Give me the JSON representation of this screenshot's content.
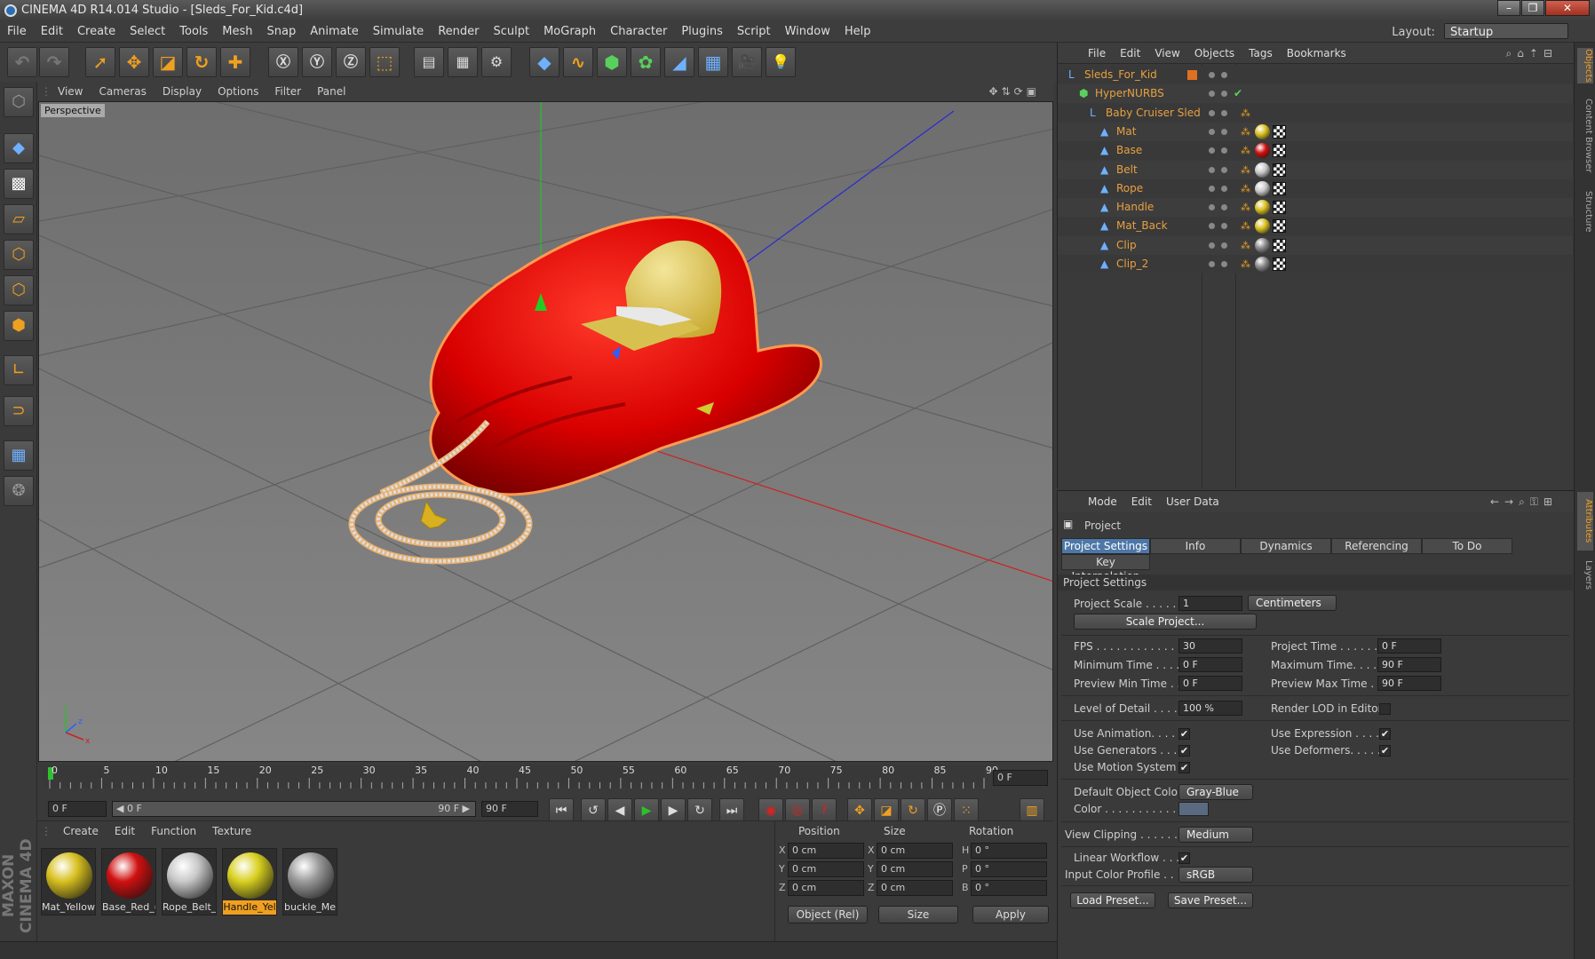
{
  "app": {
    "title": "CINEMA 4D R14.014 Studio - [Sleds_For_Kid.c4d]",
    "layout_label": "Layout:",
    "layout_value": "Startup"
  },
  "menu": [
    "File",
    "Edit",
    "Create",
    "Select",
    "Tools",
    "Mesh",
    "Snap",
    "Animate",
    "Simulate",
    "Render",
    "Sculpt",
    "MoGraph",
    "Character",
    "Plugins",
    "Script",
    "Window",
    "Help"
  ],
  "viewport": {
    "menu": [
      "View",
      "Cameras",
      "Display",
      "Options",
      "Filter",
      "Panel"
    ],
    "label": "Perspective"
  },
  "timeline": {
    "ticks": [
      "0",
      "5",
      "10",
      "15",
      "20",
      "25",
      "30",
      "35",
      "40",
      "45",
      "50",
      "55",
      "60",
      "65",
      "70",
      "75",
      "80",
      "85",
      "90"
    ],
    "frame_end_field": "0 F",
    "current_frame": "0 F",
    "range_start": "◀ 0 F",
    "range_end": "90 F ▶",
    "max_frame": "90 F"
  },
  "materials": {
    "menu": [
      "Create",
      "Edit",
      "Function",
      "Texture"
    ],
    "items": [
      {
        "name": "Mat_Yellow",
        "color": "#d8c020"
      },
      {
        "name": "Base_Red_(",
        "color": "#d01010"
      },
      {
        "name": "Rope_Belt_",
        "color": "#c8c8c8"
      },
      {
        "name": "Handle_Yel",
        "color": "#d8d020",
        "selected": true
      },
      {
        "name": "buckle_Me",
        "color": "#9a9a9a"
      }
    ],
    "brand": "MAXON CINEMA 4D"
  },
  "coords": {
    "headers": [
      "Position",
      "Size",
      "Rotation"
    ],
    "rows": [
      {
        "axis": "X",
        "pos": "0 cm",
        "size_axis": "X",
        "size": "0 cm",
        "rot_axis": "H",
        "rot": "0 °"
      },
      {
        "axis": "Y",
        "pos": "0 cm",
        "size_axis": "Y",
        "size": "0 cm",
        "rot_axis": "P",
        "rot": "0 °"
      },
      {
        "axis": "Z",
        "pos": "0 cm",
        "size_axis": "Z",
        "size": "0 cm",
        "rot_axis": "B",
        "rot": "0 °"
      }
    ],
    "mode": "Object (Rel)",
    "size_mode": "Size",
    "apply": "Apply"
  },
  "objects": {
    "menu": [
      "File",
      "Edit",
      "View",
      "Objects",
      "Tags",
      "Bookmarks"
    ],
    "tree": [
      {
        "name": "Sleds_For_Kid",
        "depth": 0
      },
      {
        "name": "HyperNURBS",
        "depth": 1
      },
      {
        "name": "Baby Cruiser Sled",
        "depth": 2
      },
      {
        "name": "Mat",
        "depth": 3,
        "mat": "#d8c020"
      },
      {
        "name": "Base",
        "depth": 3,
        "mat": "#d01010"
      },
      {
        "name": "Belt",
        "depth": 3,
        "mat": "#c8c8c8"
      },
      {
        "name": "Rope",
        "depth": 3,
        "mat": "#c8c8c8"
      },
      {
        "name": "Handle",
        "depth": 3,
        "mat": "#d8c020"
      },
      {
        "name": "Mat_Back",
        "depth": 3,
        "mat": "#d8c020"
      },
      {
        "name": "Clip",
        "depth": 3,
        "mat": "#8a8a8a"
      },
      {
        "name": "Clip_2",
        "depth": 3,
        "mat": "#8a8a8a"
      }
    ]
  },
  "attributes": {
    "menu": [
      "Mode",
      "Edit",
      "User Data"
    ],
    "header": "Project",
    "tabs": [
      "Project Settings",
      "Info",
      "Dynamics",
      "Referencing",
      "To Do"
    ],
    "tab2": "Key Interpolation",
    "section": "Project Settings",
    "project_scale_label": "Project Scale . . . . . .",
    "project_scale_value": "1",
    "project_scale_unit": "Centimeters",
    "scale_button": "Scale Project...",
    "fps_label": "FPS . . . . . . . . . . . . . .",
    "fps_value": "30",
    "project_time_label": "Project Time . . . . . . . .",
    "project_time_value": "0 F",
    "min_time_label": "Minimum Time . . . . .",
    "min_time_value": "0 F",
    "max_time_label": "Maximum Time. . . . . .",
    "max_time_value": "90 F",
    "prev_min_label": "Preview Min Time . .",
    "prev_min_value": "0 F",
    "prev_max_label": "Preview Max Time . . .",
    "prev_max_value": "90 F",
    "lod_label": "Level of Detail . . . . .",
    "lod_value": "100 %",
    "render_lod_label": "Render LOD in Editor",
    "use_anim_label": "Use Animation. . . . .",
    "use_expr_label": "Use Expression . . . . .",
    "use_gen_label": "Use Generators . . . .",
    "use_def_label": "Use Deformers. . . . . .",
    "use_motion_label": "Use Motion System",
    "default_color_label": "Default Object Color",
    "default_color_value": "Gray-Blue",
    "color_label": "Color . . . . . . . . . . . .",
    "view_clipping_label": "View Clipping . . . . . .",
    "view_clipping_value": "Medium",
    "linear_label": "Linear Workflow . . . .",
    "input_profile_label": "Input Color Profile . .",
    "input_profile_value": "sRGB",
    "load_preset": "Load Preset...",
    "save_preset": "Save Preset..."
  },
  "right_tabs": [
    "Objects",
    "Content Browser",
    "Structure",
    "Attributes",
    "Layers"
  ]
}
